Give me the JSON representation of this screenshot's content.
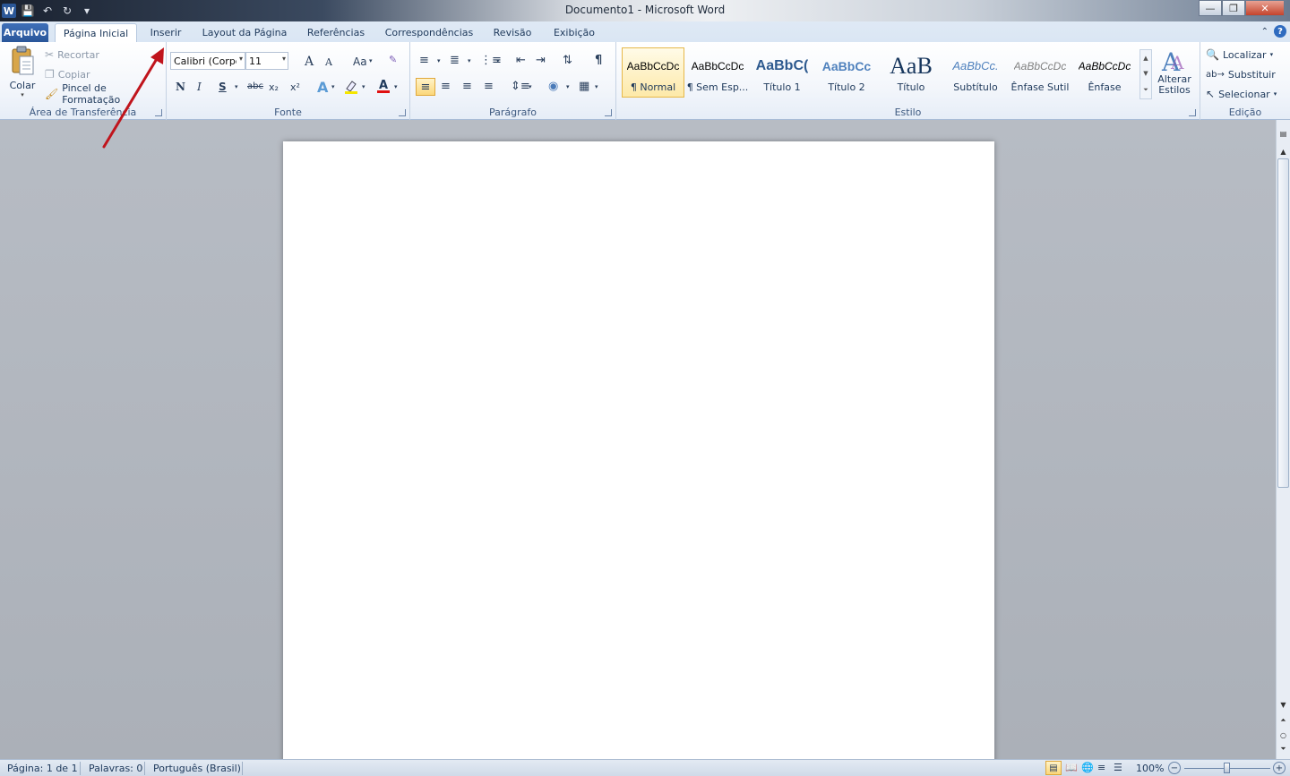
{
  "window": {
    "title": "Documento1 - Microsoft Word",
    "app_icon_letter": "W"
  },
  "tabs": {
    "file": "Arquivo",
    "home": "Página Inicial",
    "insert": "Inserir",
    "layout": "Layout da Página",
    "references": "Referências",
    "mailings": "Correspondências",
    "review": "Revisão",
    "view": "Exibição"
  },
  "clipboard": {
    "paste": "Colar",
    "cut": "Recortar",
    "copy": "Copiar",
    "format_painter": "Pincel de Formatação",
    "label": "Área de Transferência"
  },
  "font": {
    "family": "Calibri (Corpo)",
    "size": "11",
    "label": "Fonte",
    "bold": "N",
    "italic": "I",
    "underline": "S",
    "strike": "abc",
    "subscript": "x₂",
    "superscript": "x²",
    "change_case": "Aa",
    "grow": "A",
    "shrink": "A"
  },
  "paragraph": {
    "label": "Parágrafo"
  },
  "styles": {
    "label": "Estilo",
    "items": [
      {
        "sample": "AaBbCcDc",
        "name": "¶ Normal"
      },
      {
        "sample": "AaBbCcDc",
        "name": "¶ Sem Esp..."
      },
      {
        "sample": "AaBbC(",
        "name": "Título 1"
      },
      {
        "sample": "AaBbCc",
        "name": "Título 2"
      },
      {
        "sample": "AaB",
        "name": "Título"
      },
      {
        "sample": "AaBbCc.",
        "name": "Subtítulo"
      },
      {
        "sample": "AaBbCcDc",
        "name": "Ênfase Sutil"
      },
      {
        "sample": "AaBbCcDc",
        "name": "Ênfase"
      }
    ],
    "change_styles_line1": "Alterar",
    "change_styles_line2": "Estilos"
  },
  "editing": {
    "label": "Edição",
    "find": "Localizar",
    "replace": "Substituir",
    "select": "Selecionar"
  },
  "status": {
    "page": "Página: 1 de 1",
    "words": "Palavras: 0",
    "language": "Português (Brasil)",
    "zoom": "100%"
  },
  "colors": {
    "accent": "#2a5699",
    "annotation_arrow": "#c0141c"
  }
}
